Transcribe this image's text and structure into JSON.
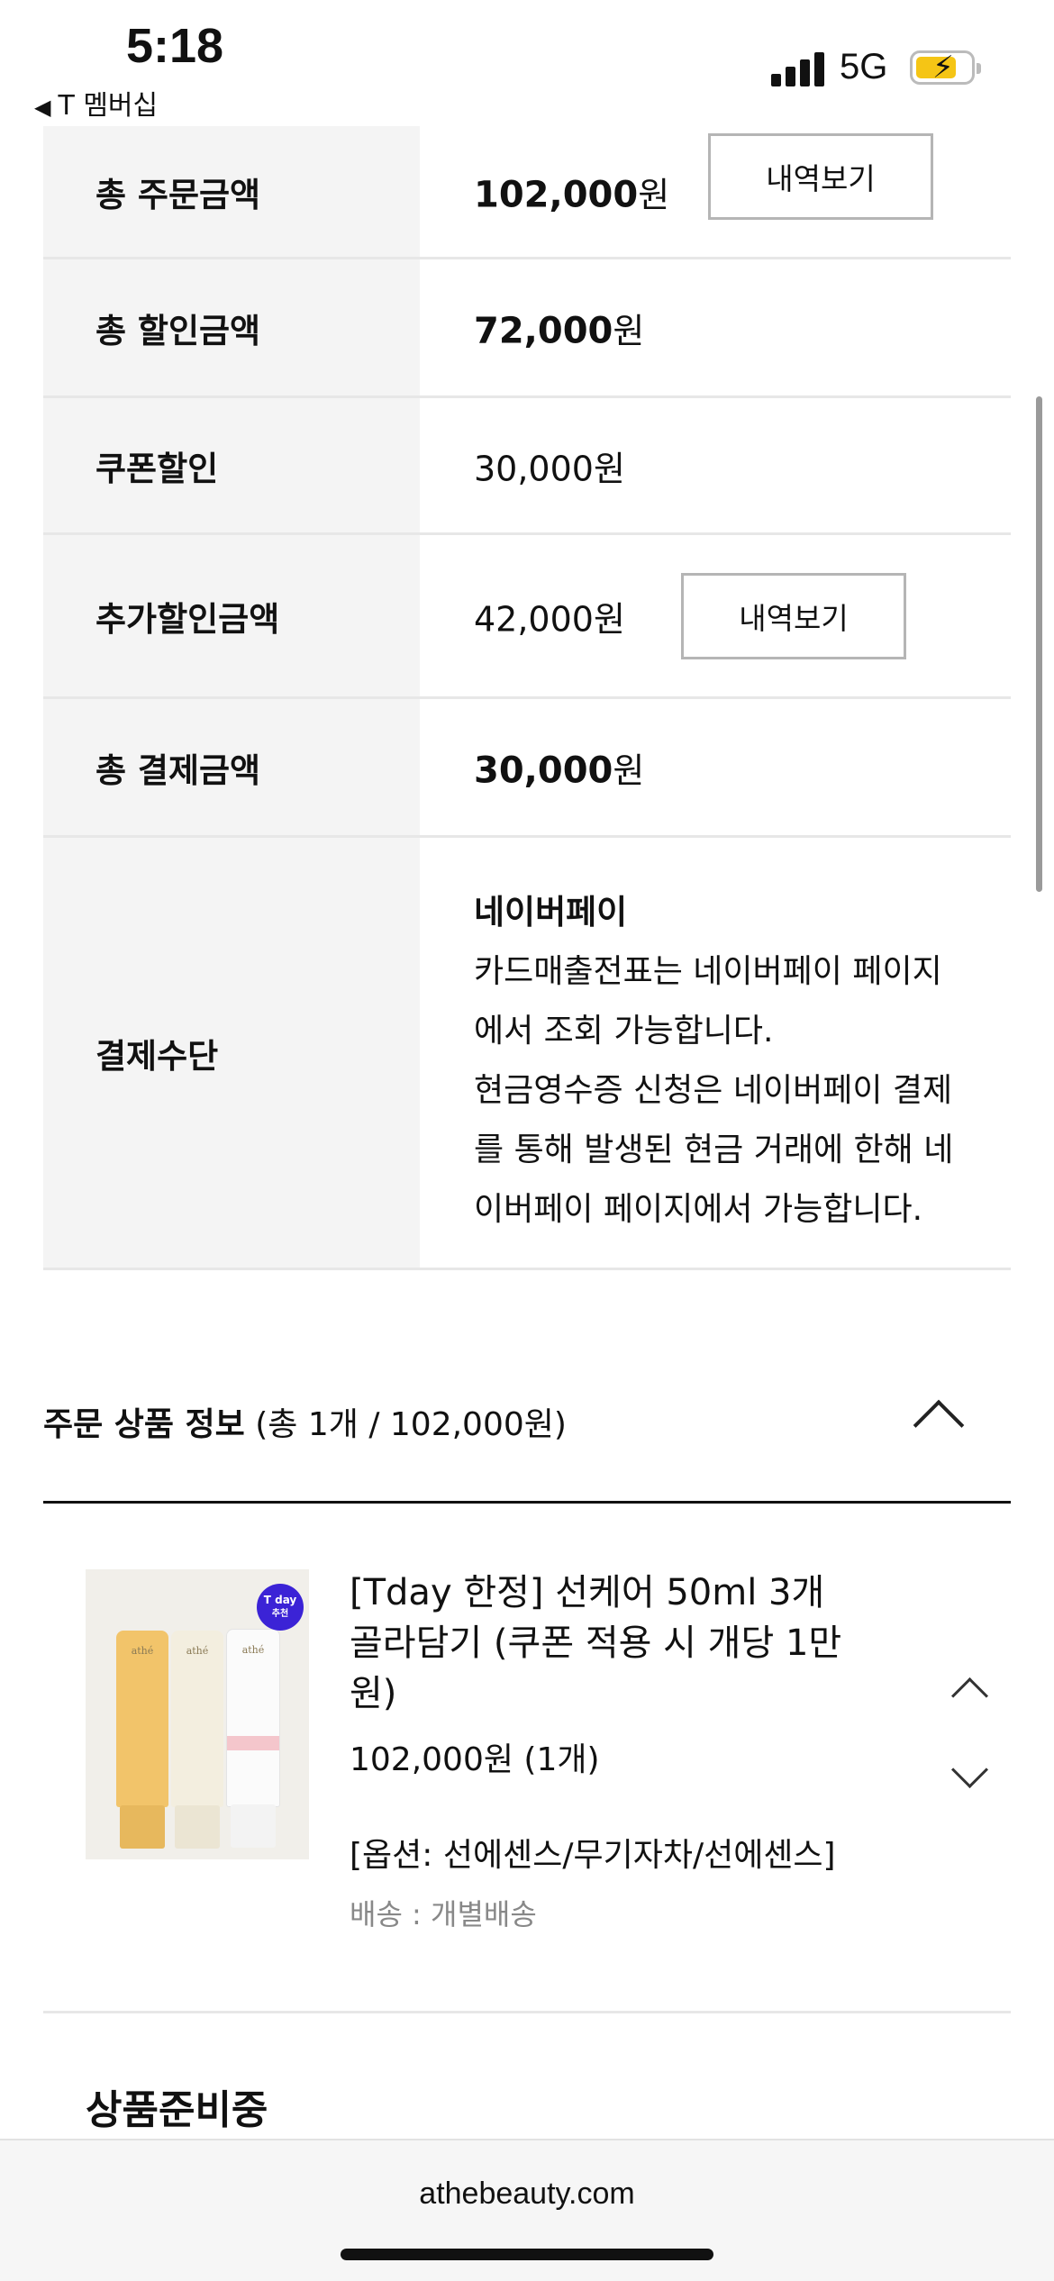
{
  "status_bar": {
    "time": "5:18",
    "back_label": "T 멤버십",
    "network": "5G"
  },
  "summary": [
    {
      "label": "총 주문금액",
      "amount": "102,000",
      "unit": "원",
      "bold": true,
      "button": "내역보기"
    },
    {
      "label": "총 할인금액",
      "amount": "72,000",
      "unit": "원",
      "bold": true
    },
    {
      "label": "쿠폰할인",
      "amount": "30,000원",
      "bold": false
    },
    {
      "label": "추가할인금액",
      "amount": "42,000원",
      "bold": false,
      "button": "내역보기"
    },
    {
      "label": "총 결제금액",
      "amount": "30,000",
      "unit": "원",
      "bold": true
    }
  ],
  "payment": {
    "label": "결제수단",
    "method": "네이버페이",
    "lines": [
      "카드매출전표는 네이버페이 페이지",
      "에서 조회 가능합니다.",
      "현금영수증 신청은 네이버페이 결제",
      "를 통해 발생된 현금 거래에 한해 네",
      "이버페이 페이지에서 가능합니다."
    ]
  },
  "order_section": {
    "title": "주문 상품 정보",
    "summary": "(총 1개 / 102,000원)"
  },
  "product": {
    "badge_top": "T day",
    "badge_bottom": "추천",
    "brand": "athé",
    "name_lines": [
      "[Tday 한정] 선케어 50ml 3개",
      "골라담기 (쿠폰 적용 시 개당 1만",
      "원)"
    ],
    "price": "102,000원 (1개)",
    "option": "[옵션: 선에센스/무기자차/선에센스]",
    "shipping": "배송 : 개별배송"
  },
  "status_heading": "상품준비중",
  "browser": {
    "url": "athebeauty.com"
  },
  "colors": {
    "accent_badge": "#3b23d6",
    "label_bg": "#f4f4f4",
    "battery_fill": "#f5c515"
  }
}
